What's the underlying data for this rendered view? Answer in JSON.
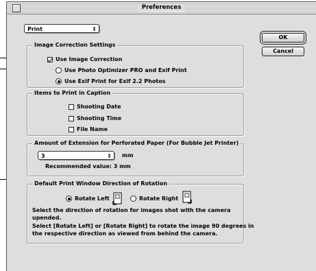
{
  "window": {
    "title": "Preferences"
  },
  "category_popup": {
    "value": "Print"
  },
  "buttons": {
    "ok": "OK",
    "cancel": "Cancel"
  },
  "image_correction": {
    "group_label": "Image Correction Settings",
    "use_correction": "Use Image Correction",
    "use_correction_checked": true,
    "options": [
      {
        "label": "Use Photo Optimizer PRO and Exif Print",
        "selected": false
      },
      {
        "label": "Use Exif Print for Exif 2.2 Photos",
        "selected": true
      }
    ]
  },
  "caption": {
    "group_label": "Items to Print in Caption",
    "items": [
      {
        "label": "Shooting Date",
        "checked": false
      },
      {
        "label": "Shooting Time",
        "checked": false
      },
      {
        "label": "File Name",
        "checked": false
      }
    ]
  },
  "extension": {
    "group_label": "Amount of Extension for Perforated Paper (For Bubble Jet Printer)",
    "value": "3",
    "unit": "mm",
    "recommended": "Recommended value: 3 mm"
  },
  "rotation": {
    "group_label": "Default Print Window Direction of Rotation",
    "left_label": "Rotate Left",
    "right_label": "Rotate Right",
    "left_selected": true,
    "note1": "Select the direction of rotation for images shot with the camera",
    "note2": "upended.",
    "note3": "Select [Rotate Left] or [Rotate Right] to rotate the image 90 degrees in",
    "note4": "the respective direction as viewed from behind the camera."
  }
}
